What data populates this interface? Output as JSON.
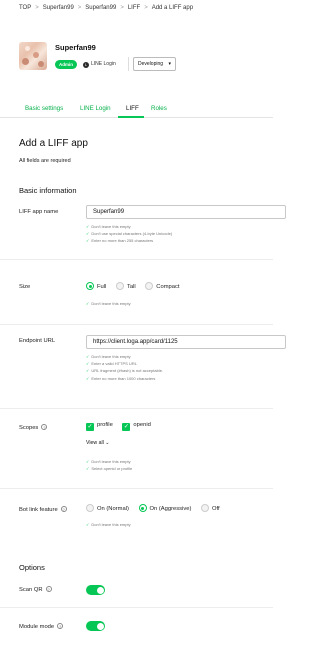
{
  "breadcrumb": [
    "TOP",
    "Superfan99",
    "Superfan99",
    "LIFF",
    "Add a LIFF app"
  ],
  "breadcrumb_sep": ">",
  "channel": {
    "name": "Superfan99",
    "role_badge": "Admin",
    "type_label": "LINE Login",
    "type_icon_glyph": "L",
    "status": "Developing",
    "status_chevron": "▾"
  },
  "tabs": [
    {
      "label": "Basic settings",
      "active": false
    },
    {
      "label": "LINE Login",
      "active": false
    },
    {
      "label": "LIFF",
      "active": true
    },
    {
      "label": "Roles",
      "active": false
    }
  ],
  "page": {
    "title": "Add a LIFF app",
    "required_note": "All fields are required"
  },
  "basic_info": {
    "heading": "Basic information",
    "app_name": {
      "label": "LIFF app name",
      "value": "Superfan99",
      "hints": [
        "Don't leave this empty",
        "Don't use special characters (4-byte Unicode)",
        "Enter no more than 255 characters"
      ]
    },
    "size": {
      "label": "Size",
      "options": [
        {
          "label": "Full",
          "selected": true
        },
        {
          "label": "Tall",
          "selected": false
        },
        {
          "label": "Compact",
          "selected": false
        }
      ],
      "hints": [
        "Don't leave this empty"
      ]
    },
    "endpoint": {
      "label": "Endpoint URL",
      "value": "https://client.loga.app/card/1125",
      "hints": [
        "Don't leave this empty",
        "Enter a valid HTTPS URL",
        "URL fragment (#hash) is not acceptable.",
        "Enter no more than 1000 characters"
      ]
    },
    "scopes": {
      "label": "Scopes",
      "options": [
        {
          "label": "profile",
          "checked": true
        },
        {
          "label": "openid",
          "checked": true
        }
      ],
      "view_all": "View all",
      "view_all_chevron": "⌄",
      "hints": [
        "Don't leave this empty",
        "Select openid or profile"
      ]
    },
    "bot_link": {
      "label": "Bot link feature",
      "options": [
        {
          "label": "On (Normal)",
          "selected": false
        },
        {
          "label": "On (Aggressive)",
          "selected": true
        },
        {
          "label": "Off",
          "selected": false
        }
      ],
      "hints": [
        "Don't leave this empty"
      ]
    }
  },
  "options": {
    "heading": "Options",
    "scan_qr": {
      "label": "Scan QR",
      "enabled": true
    },
    "module_mode": {
      "label": "Module mode",
      "enabled": true
    }
  },
  "icons": {
    "help": "?",
    "check": "✓",
    "checkbox_check": "✓"
  },
  "colors": {
    "accent": "#06c755",
    "tab_link": "#06b14b"
  }
}
